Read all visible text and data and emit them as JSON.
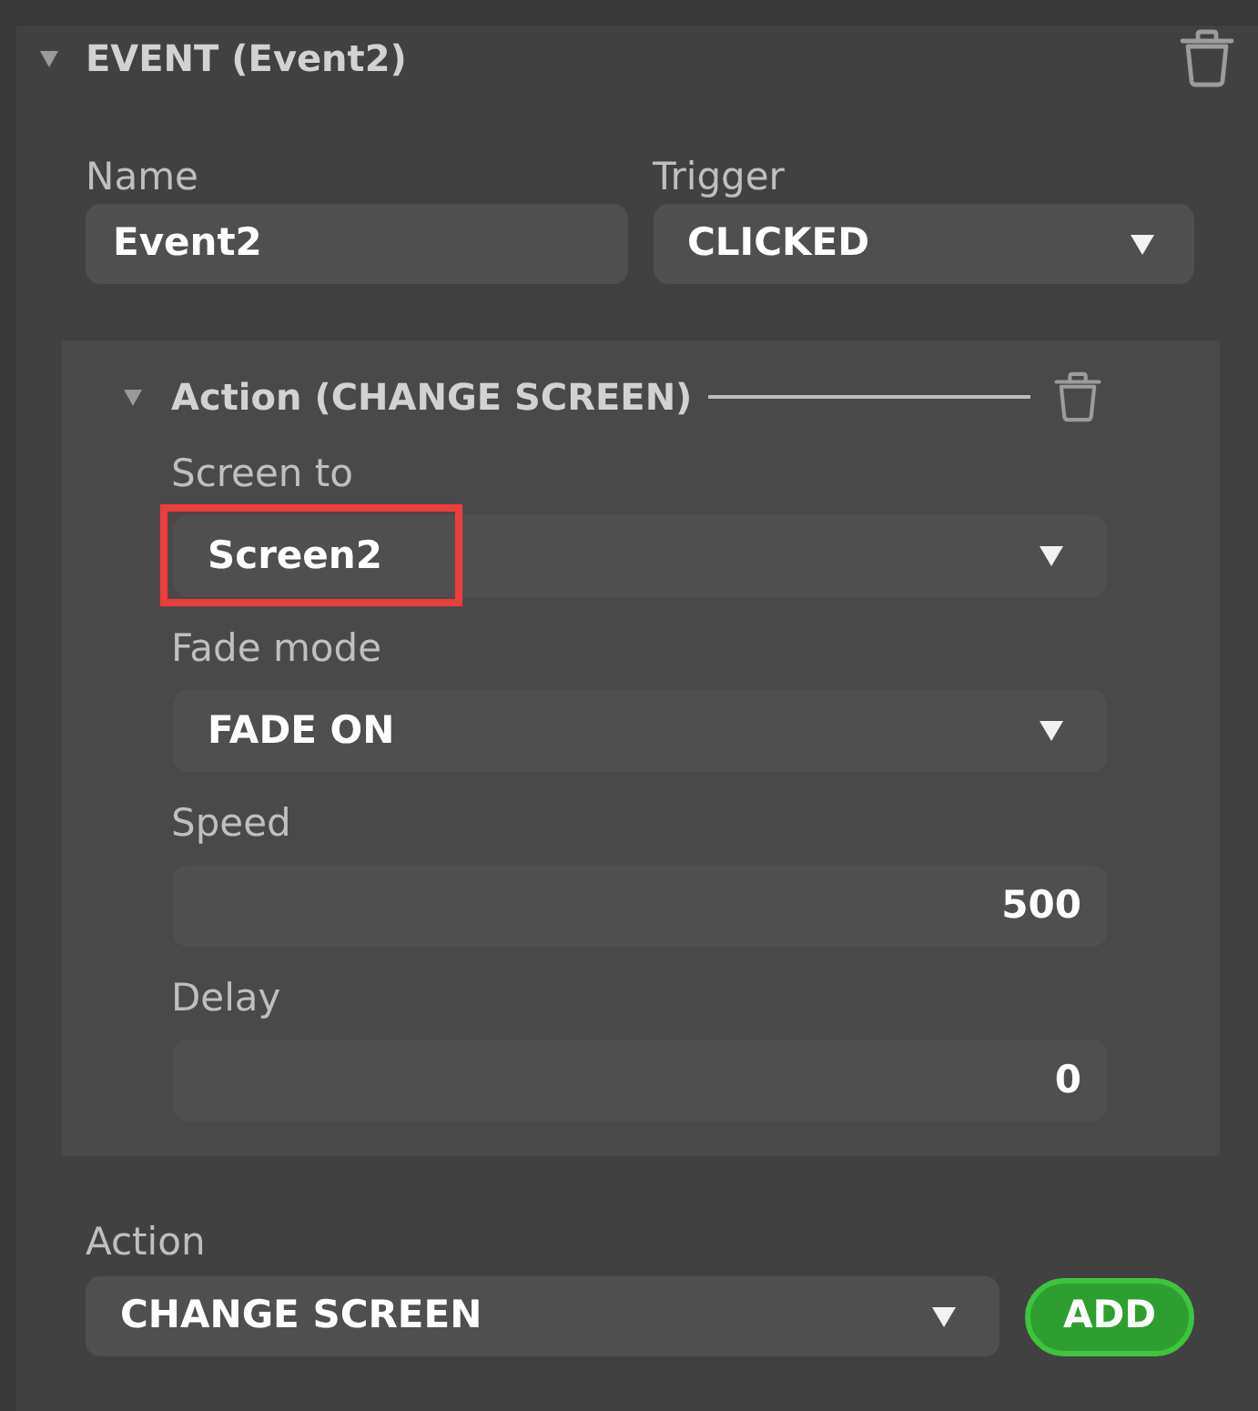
{
  "event": {
    "title": "EVENT (Event2)",
    "expanded": true,
    "fields": [
      {
        "kind": "text",
        "label": "Name",
        "value": "Event2"
      },
      {
        "kind": "dropdown",
        "label": "Trigger",
        "value": "CLICKED"
      }
    ],
    "actions": [
      {
        "title": "Action (CHANGE SCREEN)",
        "expanded": true,
        "fields": [
          {
            "kind": "dropdown",
            "label": "Screen to",
            "value": "Screen2",
            "highlighted": true
          },
          {
            "kind": "dropdown",
            "label": "Fade mode",
            "value": "FADE ON",
            "highlighted": false
          },
          {
            "kind": "number",
            "label": "Speed",
            "value": "500",
            "highlighted": false
          },
          {
            "kind": "number",
            "label": "Delay",
            "value": "0",
            "highlighted": false
          }
        ]
      }
    ],
    "add_action": {
      "label": "Action",
      "value": "CHANGE SCREEN",
      "button": "ADD"
    }
  }
}
